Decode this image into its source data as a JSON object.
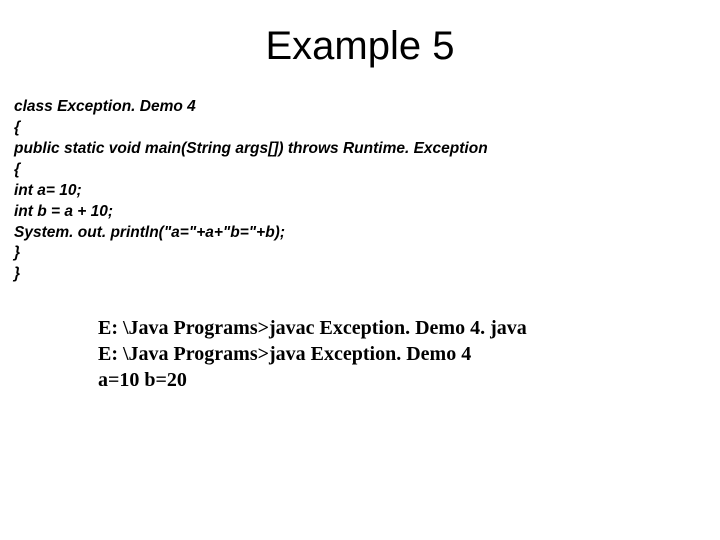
{
  "title": "Example 5",
  "code": {
    "lines": [
      "class Exception. Demo 4",
      "{",
      "public static void main(String args[]) throws Runtime. Exception",
      "{",
      "int a= 10;",
      "int b = a + 10;",
      "System. out. println(\"a=\"+a+\"b=\"+b);",
      "}",
      "}"
    ]
  },
  "output": {
    "lines": [
      "E: \\Java Programs>javac Exception. Demo 4. java",
      "E: \\Java Programs>java Exception. Demo 4",
      "a=10 b=20"
    ]
  }
}
